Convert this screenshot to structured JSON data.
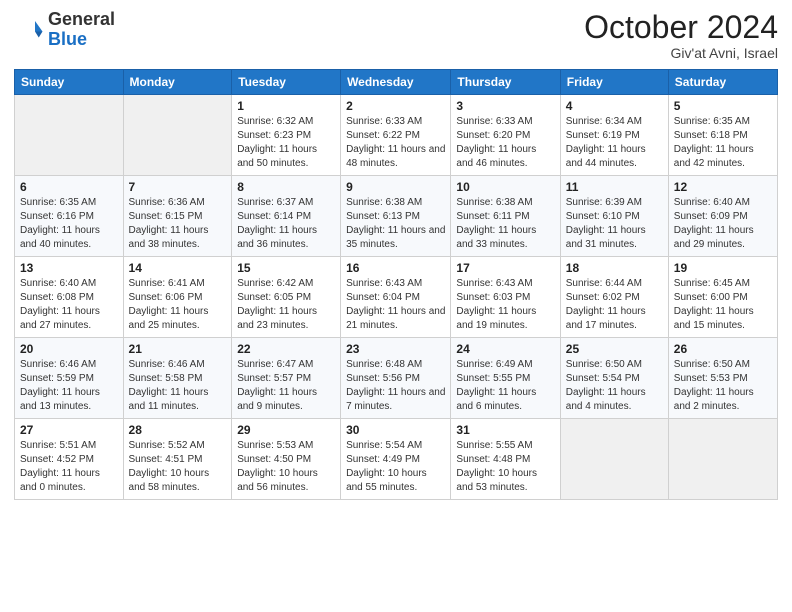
{
  "logo": {
    "general": "General",
    "blue": "Blue"
  },
  "title": "October 2024",
  "location": "Giv'at Avni, Israel",
  "days_of_week": [
    "Sunday",
    "Monday",
    "Tuesday",
    "Wednesday",
    "Thursday",
    "Friday",
    "Saturday"
  ],
  "weeks": [
    [
      {
        "day": "",
        "info": ""
      },
      {
        "day": "",
        "info": ""
      },
      {
        "day": "1",
        "info": "Sunrise: 6:32 AM\nSunset: 6:23 PM\nDaylight: 11 hours and 50 minutes."
      },
      {
        "day": "2",
        "info": "Sunrise: 6:33 AM\nSunset: 6:22 PM\nDaylight: 11 hours and 48 minutes."
      },
      {
        "day": "3",
        "info": "Sunrise: 6:33 AM\nSunset: 6:20 PM\nDaylight: 11 hours and 46 minutes."
      },
      {
        "day": "4",
        "info": "Sunrise: 6:34 AM\nSunset: 6:19 PM\nDaylight: 11 hours and 44 minutes."
      },
      {
        "day": "5",
        "info": "Sunrise: 6:35 AM\nSunset: 6:18 PM\nDaylight: 11 hours and 42 minutes."
      }
    ],
    [
      {
        "day": "6",
        "info": "Sunrise: 6:35 AM\nSunset: 6:16 PM\nDaylight: 11 hours and 40 minutes."
      },
      {
        "day": "7",
        "info": "Sunrise: 6:36 AM\nSunset: 6:15 PM\nDaylight: 11 hours and 38 minutes."
      },
      {
        "day": "8",
        "info": "Sunrise: 6:37 AM\nSunset: 6:14 PM\nDaylight: 11 hours and 36 minutes."
      },
      {
        "day": "9",
        "info": "Sunrise: 6:38 AM\nSunset: 6:13 PM\nDaylight: 11 hours and 35 minutes."
      },
      {
        "day": "10",
        "info": "Sunrise: 6:38 AM\nSunset: 6:11 PM\nDaylight: 11 hours and 33 minutes."
      },
      {
        "day": "11",
        "info": "Sunrise: 6:39 AM\nSunset: 6:10 PM\nDaylight: 11 hours and 31 minutes."
      },
      {
        "day": "12",
        "info": "Sunrise: 6:40 AM\nSunset: 6:09 PM\nDaylight: 11 hours and 29 minutes."
      }
    ],
    [
      {
        "day": "13",
        "info": "Sunrise: 6:40 AM\nSunset: 6:08 PM\nDaylight: 11 hours and 27 minutes."
      },
      {
        "day": "14",
        "info": "Sunrise: 6:41 AM\nSunset: 6:06 PM\nDaylight: 11 hours and 25 minutes."
      },
      {
        "day": "15",
        "info": "Sunrise: 6:42 AM\nSunset: 6:05 PM\nDaylight: 11 hours and 23 minutes."
      },
      {
        "day": "16",
        "info": "Sunrise: 6:43 AM\nSunset: 6:04 PM\nDaylight: 11 hours and 21 minutes."
      },
      {
        "day": "17",
        "info": "Sunrise: 6:43 AM\nSunset: 6:03 PM\nDaylight: 11 hours and 19 minutes."
      },
      {
        "day": "18",
        "info": "Sunrise: 6:44 AM\nSunset: 6:02 PM\nDaylight: 11 hours and 17 minutes."
      },
      {
        "day": "19",
        "info": "Sunrise: 6:45 AM\nSunset: 6:00 PM\nDaylight: 11 hours and 15 minutes."
      }
    ],
    [
      {
        "day": "20",
        "info": "Sunrise: 6:46 AM\nSunset: 5:59 PM\nDaylight: 11 hours and 13 minutes."
      },
      {
        "day": "21",
        "info": "Sunrise: 6:46 AM\nSunset: 5:58 PM\nDaylight: 11 hours and 11 minutes."
      },
      {
        "day": "22",
        "info": "Sunrise: 6:47 AM\nSunset: 5:57 PM\nDaylight: 11 hours and 9 minutes."
      },
      {
        "day": "23",
        "info": "Sunrise: 6:48 AM\nSunset: 5:56 PM\nDaylight: 11 hours and 7 minutes."
      },
      {
        "day": "24",
        "info": "Sunrise: 6:49 AM\nSunset: 5:55 PM\nDaylight: 11 hours and 6 minutes."
      },
      {
        "day": "25",
        "info": "Sunrise: 6:50 AM\nSunset: 5:54 PM\nDaylight: 11 hours and 4 minutes."
      },
      {
        "day": "26",
        "info": "Sunrise: 6:50 AM\nSunset: 5:53 PM\nDaylight: 11 hours and 2 minutes."
      }
    ],
    [
      {
        "day": "27",
        "info": "Sunrise: 5:51 AM\nSunset: 4:52 PM\nDaylight: 11 hours and 0 minutes."
      },
      {
        "day": "28",
        "info": "Sunrise: 5:52 AM\nSunset: 4:51 PM\nDaylight: 10 hours and 58 minutes."
      },
      {
        "day": "29",
        "info": "Sunrise: 5:53 AM\nSunset: 4:50 PM\nDaylight: 10 hours and 56 minutes."
      },
      {
        "day": "30",
        "info": "Sunrise: 5:54 AM\nSunset: 4:49 PM\nDaylight: 10 hours and 55 minutes."
      },
      {
        "day": "31",
        "info": "Sunrise: 5:55 AM\nSunset: 4:48 PM\nDaylight: 10 hours and 53 minutes."
      },
      {
        "day": "",
        "info": ""
      },
      {
        "day": "",
        "info": ""
      }
    ]
  ]
}
